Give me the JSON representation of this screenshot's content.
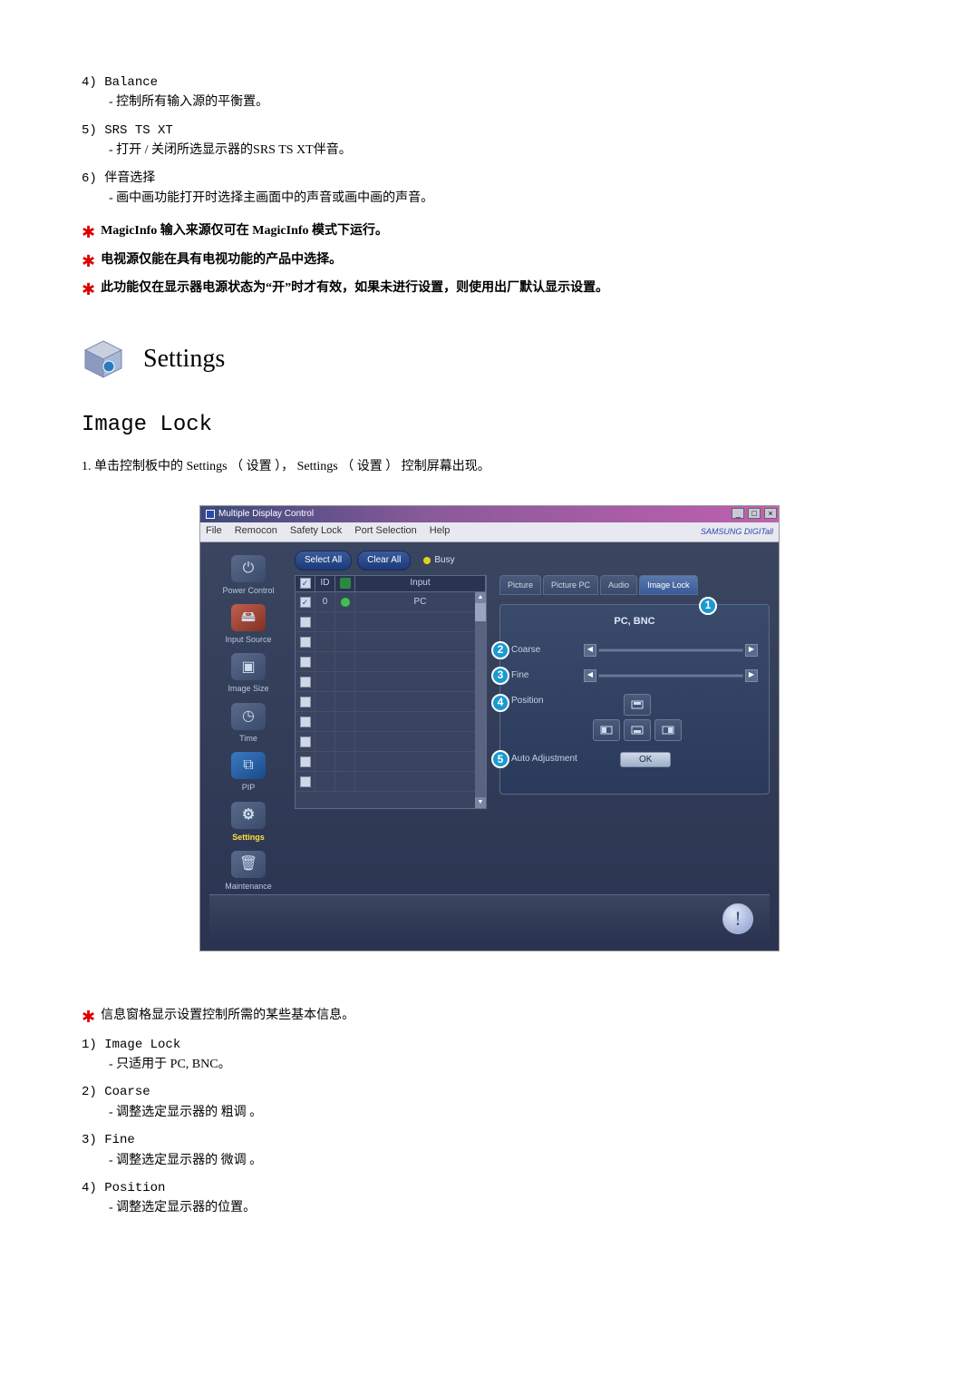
{
  "top_items": [
    {
      "num": "4)",
      "title": "Balance",
      "desc": "- 控制所有输入源的平衡置。"
    },
    {
      "num": "5)",
      "title": "SRS TS XT",
      "desc": "- 打开 / 关闭所选显示器的SRS TS XT伴音。"
    },
    {
      "num": "6)",
      "title": "伴音选择",
      "desc": "- 画中画功能打开时选择主画面中的声音或画中画的声音。"
    }
  ],
  "stars": [
    "MagicInfo 输入来源仅可在 MagicInfo 模式下运行。",
    "电视源仅能在具有电视功能的产品中选择。",
    "此功能仅在显示器电源状态为“开”时才有效，如果未进行设置，则使用出厂默认显示设置。"
  ],
  "settings_heading": "Settings",
  "section_title": "Image Lock",
  "main_instruction": "1. 单击控制板中的 Settings （ 设置 ）， Settings （ 设置 ） 控制屏幕出现。",
  "app": {
    "title": "Multiple Display Control",
    "brand": "SAMSUNG DIGITall",
    "menu": [
      "File",
      "Remocon",
      "Safety Lock",
      "Port Selection",
      "Help"
    ],
    "winbtns": [
      "_",
      "□",
      "×"
    ],
    "buttons": {
      "select_all": "Select All",
      "clear_all": "Clear All",
      "busy": "Busy"
    },
    "grid": {
      "headers": [
        "☑",
        "ID",
        "⟳",
        "Input"
      ],
      "row": {
        "id": "0",
        "input": "PC"
      }
    },
    "sidebar": [
      {
        "label": "Power Control",
        "glyph": "⏻"
      },
      {
        "label": "Input Source",
        "glyph": "🖴"
      },
      {
        "label": "Image Size",
        "glyph": "▣"
      },
      {
        "label": "Time",
        "glyph": "◷"
      },
      {
        "label": "PIP",
        "glyph": "⧉"
      },
      {
        "label": "Settings",
        "glyph": "⚙",
        "active": true
      },
      {
        "label": "Maintenance",
        "glyph": "🗑"
      }
    ],
    "tabs": [
      "Picture",
      "Picture PC",
      "Audio",
      "Image Lock"
    ],
    "panel": {
      "head": "PC, BNC",
      "coarse": "Coarse",
      "fine": "Fine",
      "position": "Position",
      "auto": "Auto Adjustment",
      "ok": "OK"
    },
    "badges": {
      "b1": "1",
      "b2": "2",
      "b3": "3",
      "b4": "4",
      "b5": "5"
    }
  },
  "info_star": "信息窗格显示设置控制所需的某些基本信息。",
  "bottom_items": [
    {
      "num": "1)",
      "title": "Image Lock",
      "desc": "- 只适用于 PC, BNC。"
    },
    {
      "num": "2)",
      "title": "Coarse",
      "desc": "- 调整选定显示器的 粗调 。"
    },
    {
      "num": "3)",
      "title": "Fine",
      "desc": "- 调整选定显示器的 微调 。"
    },
    {
      "num": "4)",
      "title": "Position",
      "desc": "- 调整选定显示器的位置。"
    }
  ]
}
